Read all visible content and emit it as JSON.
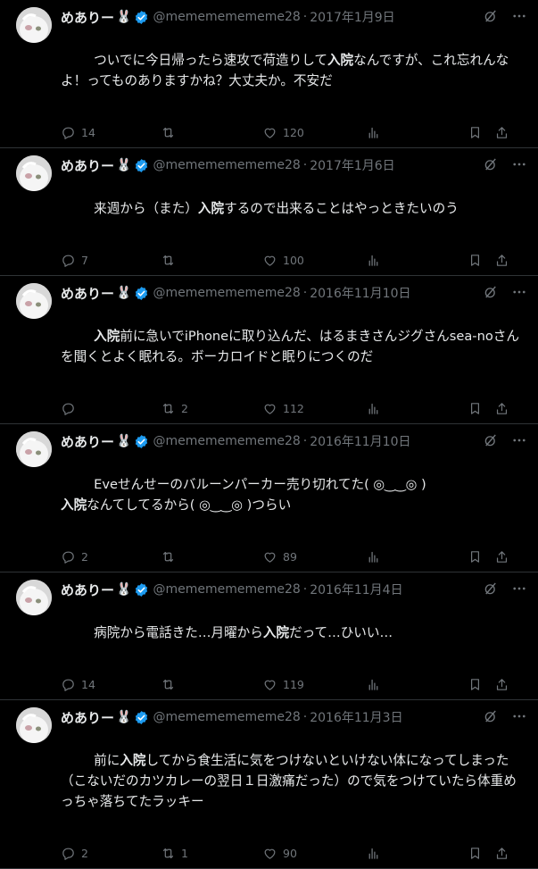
{
  "tweets": [
    {
      "name": "めありー",
      "emoji": "🐰",
      "handle": "@memememememe28",
      "sep": "·",
      "date": "2017年1月9日",
      "text_parts": [
        "ついでに今日帰ったら速攻で荷造りして",
        "入院",
        "なんですが、これ忘れんなよ！ってものありますかね？大丈夫か。不安だ"
      ],
      "replies": "14",
      "retweets": "",
      "likes": "120"
    },
    {
      "name": "めありー",
      "emoji": "🐰",
      "handle": "@memememememe28",
      "sep": "·",
      "date": "2017年1月6日",
      "text_parts": [
        "来週から（また）",
        "入院",
        "するので出来ることはやっときたいのう"
      ],
      "replies": "7",
      "retweets": "",
      "likes": "100"
    },
    {
      "name": "めありー",
      "emoji": "🐰",
      "handle": "@memememememe28",
      "sep": "·",
      "date": "2016年11月10日",
      "text_parts": [
        "",
        "入院",
        "前に急いでiPhoneに取り込んだ、はるまきさんジグさんsea-noさんを聞くとよく眠れる。ボーカロイドと眠りにつくのだ"
      ],
      "replies": "",
      "retweets": "2",
      "likes": "112"
    },
    {
      "name": "めありー",
      "emoji": "🐰",
      "handle": "@memememememe28",
      "sep": "·",
      "date": "2016年11月10日",
      "text_parts": [
        "Eveせんせーのバルーンパーカー売り切れてた( ◎‿‿◎ )\n",
        "入院",
        "なんてしてるから( ◎‿‿◎ )つらい"
      ],
      "replies": "2",
      "retweets": "",
      "likes": "89"
    },
    {
      "name": "めありー",
      "emoji": "🐰",
      "handle": "@memememememe28",
      "sep": "·",
      "date": "2016年11月4日",
      "text_parts": [
        "病院から電話きた…月曜から",
        "入院",
        "だって…ひいい…"
      ],
      "replies": "14",
      "retweets": "",
      "likes": "119"
    },
    {
      "name": "めありー",
      "emoji": "🐰",
      "handle": "@memememememe28",
      "sep": "·",
      "date": "2016年11月3日",
      "text_parts": [
        "前に",
        "入院",
        "してから食生活に気をつけないといけない体になってしまった（こないだのカツカレーの翌日１日激痛だった）ので気をつけていたら体重めっちゃ落ちてたラッキー"
      ],
      "replies": "2",
      "retweets": "1",
      "likes": "90"
    }
  ],
  "colors": {
    "bg": "#000000",
    "text": "#e7e9ea",
    "muted": "#71767b",
    "verified": "#1d9bf0",
    "divider": "#2f3336"
  },
  "icons": [
    "avatar-image",
    "verified-badge-icon",
    "grok-icon",
    "more-icon",
    "reply-icon",
    "retweet-icon",
    "like-icon",
    "views-icon",
    "bookmark-icon",
    "share-icon"
  ]
}
